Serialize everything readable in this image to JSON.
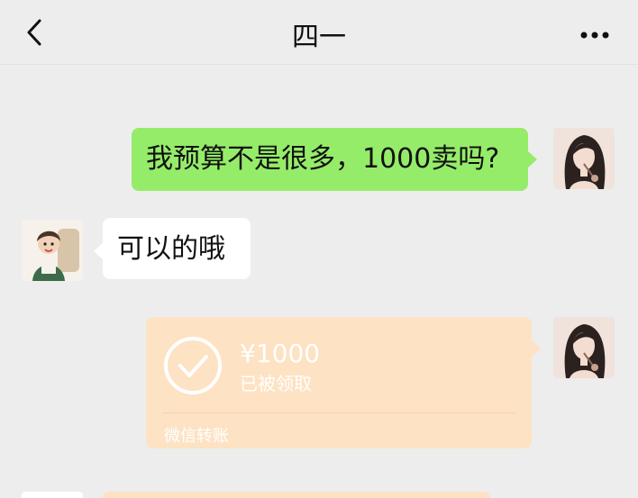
{
  "header": {
    "title": "四一"
  },
  "messages": [
    {
      "sender": "self",
      "text": "我预算不是很多，1000卖吗?"
    },
    {
      "sender": "other",
      "text": "可以的哦"
    }
  ],
  "transfer": {
    "amount": "¥1000",
    "status": "已被领取",
    "label": "微信转账"
  },
  "colors": {
    "background": "#ededed",
    "self_bubble": "#95ec69",
    "other_bubble": "#ffffff",
    "transfer_card": "#fde2c3"
  },
  "icons": {
    "back": "chevron-left-icon",
    "more": "more-dots-icon",
    "transfer_check": "check-circle-icon"
  }
}
